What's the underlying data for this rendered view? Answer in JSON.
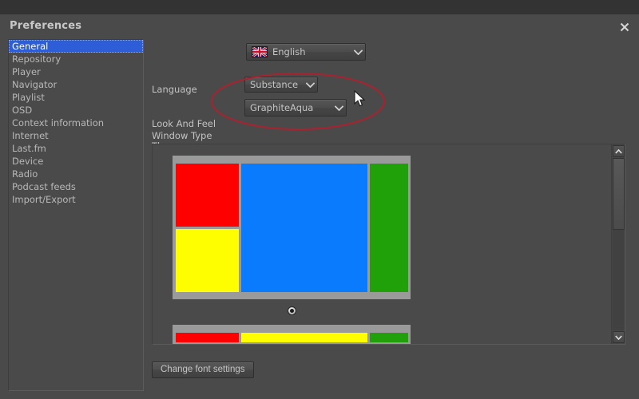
{
  "window": {
    "title": "Preferences",
    "close_icon": "close-x-icon"
  },
  "sidebar": {
    "items": [
      {
        "label": "General",
        "selected": true
      },
      {
        "label": "Repository",
        "selected": false
      },
      {
        "label": "Player",
        "selected": false
      },
      {
        "label": "Navigator",
        "selected": false
      },
      {
        "label": "Playlist",
        "selected": false
      },
      {
        "label": "OSD",
        "selected": false
      },
      {
        "label": "Context information",
        "selected": false
      },
      {
        "label": "Internet",
        "selected": false
      },
      {
        "label": "Last.fm",
        "selected": false
      },
      {
        "label": "Device",
        "selected": false
      },
      {
        "label": "Radio",
        "selected": false
      },
      {
        "label": "Podcast feeds",
        "selected": false
      },
      {
        "label": "Import/Export",
        "selected": false
      }
    ]
  },
  "general": {
    "language": {
      "label": "Language",
      "value": "English",
      "flag_icon": "union-jack-flag-icon",
      "chevron_icon": "chevron-down-icon"
    },
    "look_and_feel": {
      "label": "Look And Feel",
      "value": "Substance",
      "chevron_icon": "chevron-down-icon"
    },
    "theme": {
      "label": "Theme",
      "value": "GraphiteAqua",
      "chevron_icon": "chevron-down-icon"
    },
    "window_type": {
      "label": "Window Type",
      "layouts": [
        {
          "name": "three-column-split-left",
          "selected": true,
          "cells": [
            {
              "name": "red",
              "color": "#fe0000"
            },
            {
              "name": "yellow",
              "color": "#fefe00"
            },
            {
              "name": "blue",
              "color": "#0a7bfd"
            },
            {
              "name": "green",
              "color": "#20a009"
            }
          ]
        },
        {
          "name": "three-bar-horizontal",
          "selected": false,
          "cells": [
            {
              "name": "red",
              "color": "#fe0000"
            },
            {
              "name": "yellow",
              "color": "#fefe00"
            },
            {
              "name": "green",
              "color": "#20a009"
            }
          ]
        }
      ],
      "scrollbar": {
        "up_icon": "chevron-up-icon",
        "down_icon": "chevron-down-icon"
      }
    },
    "font_button": {
      "label": "Change font settings"
    }
  },
  "annotation": {
    "ellipse_color": "#a8232f",
    "cursor_icon": "mouse-pointer-icon"
  }
}
